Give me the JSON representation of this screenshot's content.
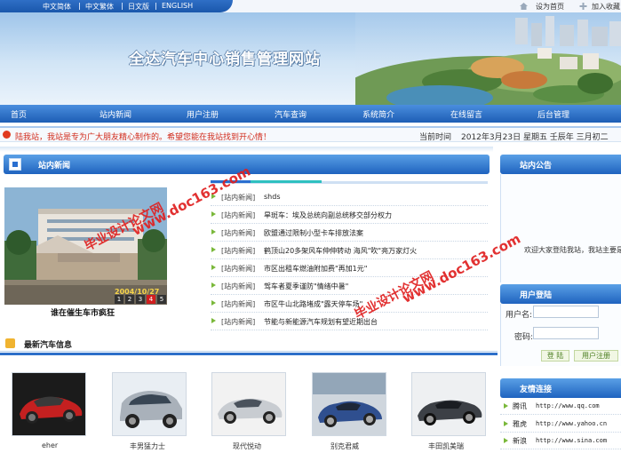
{
  "languages": [
    "中文简体",
    "中文繁体",
    "日文版",
    "ENGLISH"
  ],
  "top_links": {
    "homepage": "设为首页",
    "favorite": "加入收藏"
  },
  "site_title": "全达汽车中心销售管理网站",
  "nav": [
    "首页",
    "站内新闻",
    "用户注册",
    "汽车查询",
    "系统简介",
    "在线留言",
    "后台管理"
  ],
  "notice": "陆我站，我站是专为广大朋友精心制作的。希望您能在我站找到开心情！",
  "date": {
    "label": "当前时间",
    "value": "2012年3月23日 星期五 壬辰年 三月初二"
  },
  "news": {
    "heading": "站内新闻",
    "photo_date": "2004/10/27",
    "pager": [
      "1",
      "2",
      "3",
      "4",
      "5"
    ],
    "active_page": 4,
    "photo_caption": "谁在催生车市疯狂",
    "items": [
      {
        "category": "[站内新闻]",
        "title": "shds"
      },
      {
        "category": "[站内新闻]",
        "title": "旱斑车：埃及总统向副总统移交部分权力"
      },
      {
        "category": "[站内新闻]",
        "title": "欧盟通过限制小型卡车排放法案"
      },
      {
        "category": "[站内新闻]",
        "title": "鹤顶山20多架风车伸伸转动 海风\"吹\"亮万家灯火"
      },
      {
        "category": "[站内新闻]",
        "title": "市区出租车燃油附加费\"再加1元\""
      },
      {
        "category": "[站内新闻]",
        "title": "驾车者夏季谨防\"情绪中暑\""
      },
      {
        "category": "[站内新闻]",
        "title": "市区牛山北路堵成\"露天停车场\""
      },
      {
        "category": "[站内新闻]",
        "title": "节能与新能源汽车规划有望近期出台"
      }
    ]
  },
  "latest_cars": {
    "heading": "最新汽车信息",
    "cars": [
      "eher",
      "丰男猛力士",
      "现代悦动",
      "别克君威",
      "丰田凯美瑞"
    ]
  },
  "announcement": {
    "heading": "站内公告",
    "text": "欢迎大家登陆我站，我站主要是为广大朋友精心制作的一个汽车销售管理网站"
  },
  "login": {
    "heading": "用户登陆",
    "user_label": "用户名:",
    "pass_label": "密码:",
    "user_value": "",
    "pass_value": "",
    "login_button": "登 陆",
    "register_button": "用户注册"
  },
  "links": {
    "heading": "友情连接",
    "items": [
      {
        "name": "腾讯",
        "url": "http://www.qq.com"
      },
      {
        "name": "雅虎",
        "url": "http://www.yahoo.cn"
      },
      {
        "name": "新浪",
        "url": "http://www.sina.com"
      }
    ]
  },
  "watermarks": [
    "www.doc163.com",
    "毕业设计论文网"
  ],
  "colors": {
    "accent": "#1f63bf",
    "notice": "#d12a1a",
    "bullet": "#7ab83a",
    "watermark": "#e02020"
  }
}
